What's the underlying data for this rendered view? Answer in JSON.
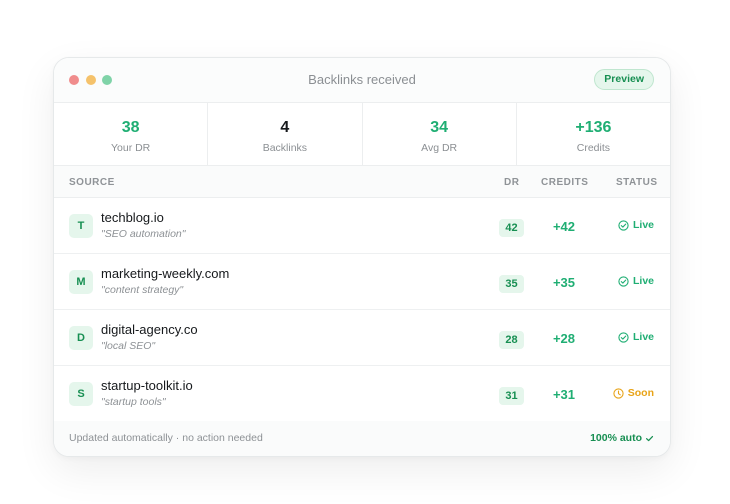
{
  "colors": {
    "accent_green": "#1fae73",
    "dark_green": "#178f52",
    "green_bg": "#e5f6ec",
    "orange": "#e8a317",
    "dot_red": "#f08c8c",
    "dot_yellow": "#f5c26b",
    "dot_green": "#7fd3a8",
    "text_dark": "#16191c"
  },
  "window": {
    "title": "Backlinks received",
    "badge": "Preview"
  },
  "stats": [
    {
      "value": "38",
      "label": "Your DR",
      "color": "#1fae73"
    },
    {
      "value": "4",
      "label": "Backlinks",
      "color": "#16191c"
    },
    {
      "value": "34",
      "label": "Avg DR",
      "color": "#1fae73"
    },
    {
      "value": "+136",
      "label": "Credits",
      "color": "#1fae73"
    }
  ],
  "table": {
    "headers": {
      "source": "SOURCE",
      "dr": "DR",
      "credits": "CREDITS",
      "status": "STATUS"
    },
    "rows": [
      {
        "initial": "T",
        "domain": "techblog.io",
        "keyword": "\"SEO automation\"",
        "dr": "42",
        "credits": "+42",
        "status": "Live",
        "status_icon": "check-circle-icon"
      },
      {
        "initial": "M",
        "domain": "marketing-weekly.com",
        "keyword": "\"content strategy\"",
        "dr": "35",
        "credits": "+35",
        "status": "Live",
        "status_icon": "check-circle-icon"
      },
      {
        "initial": "D",
        "domain": "digital-agency.co",
        "keyword": "\"local SEO\"",
        "dr": "28",
        "credits": "+28",
        "status": "Live",
        "status_icon": "check-circle-icon"
      },
      {
        "initial": "S",
        "domain": "startup-toolkit.io",
        "keyword": "\"startup tools\"",
        "dr": "31",
        "credits": "+31",
        "status": "Soon",
        "status_icon": "clock-icon"
      }
    ]
  },
  "footer": {
    "note": "Updated automatically · no action needed",
    "auto": "100% auto",
    "auto_icon": "checkmark-icon"
  }
}
